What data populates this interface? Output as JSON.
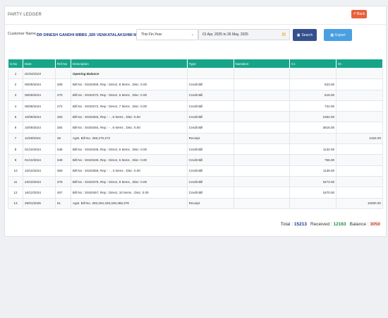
{
  "page": {
    "title": "PARTY LEDGER"
  },
  "back_button": {
    "label": "Back",
    "icon": "back-arrow-icon"
  },
  "customer": {
    "label": "Customer Name :",
    "name": "DR DINESH GANDHI MBBS ,SRI VENKATALAKSHMI MEDI CLINIC"
  },
  "filters": {
    "fin_year": "This Fin.Year",
    "date_range": "01 Apr, 2025 to 26 May, 2025"
  },
  "search_button": {
    "label": "Search",
    "icon": "save-icon"
  },
  "export_button": {
    "label": "Export",
    "icon": "export-icon"
  },
  "table": {
    "headers": [
      "S.No",
      "Date",
      "Ref.No",
      "Description",
      "Type",
      "Narration",
      "Cr.",
      "Dr."
    ],
    "rows": [
      {
        "sno": "1",
        "date": "01/04/2023",
        "ref": "",
        "desc": "Opening Balance",
        "type": "",
        "narr": "",
        "cr": "",
        "dr": ""
      },
      {
        "sno": "2",
        "date": "05/09/2024",
        "ref": "269",
        "desc": "Bill No : SSS0269, Rep : Direct, 8 Items , Disc: 0.00",
        "type": "Credit Bill",
        "narr": "",
        "cr": "623.00",
        "dr": ""
      },
      {
        "sno": "3",
        "date": "05/09/2024",
        "ref": "270",
        "desc": "Bill No : SSS0270, Rep : Direct, 6 Items , Disc: 0.00",
        "type": "Credit Bill",
        "narr": "",
        "cr": "618.00",
        "dr": ""
      },
      {
        "sno": "4",
        "date": "05/09/2024",
        "ref": "272",
        "desc": "Bill No : SSS0272, Rep : Direct, 7 Items , Disc: 0.00",
        "type": "Credit Bill",
        "narr": "",
        "cr": "722.00",
        "dr": ""
      },
      {
        "sno": "5",
        "date": "10/09/2024",
        "ref": "283",
        "desc": "Bill No : SSS0283, Rep : - , 6 Items , Disc: 0.00",
        "type": "Credit Bill",
        "narr": "",
        "cr": "1052.00",
        "dr": ""
      },
      {
        "sno": "6",
        "date": "10/09/2024",
        "ref": "284",
        "desc": "Bill No : SSS0284, Rep : - , 6 Items , Disc: 0.00",
        "type": "Credit Bill",
        "narr": "",
        "cr": "3816.00",
        "dr": ""
      },
      {
        "sno": "7",
        "date": "11/09/2024",
        "ref": "48",
        "desc": "Agst. Bill No. 269,270,272",
        "type": "Receipt",
        "narr": "",
        "cr": "",
        "dr": "2163.00"
      },
      {
        "sno": "8",
        "date": "01/10/2024",
        "ref": "348",
        "desc": "Bill No : SSS0348, Rep : Direct, 6 Items , Disc: 0.00",
        "type": "Credit Bill",
        "narr": "",
        "cr": "1132.00",
        "dr": ""
      },
      {
        "sno": "9",
        "date": "01/10/2024",
        "ref": "349",
        "desc": "Bill No : SSS0349, Rep : Direct, 6 Items , Disc: 0.00",
        "type": "Credit Bill",
        "narr": "",
        "cr": "766.00",
        "dr": ""
      },
      {
        "sno": "10",
        "date": "10/10/2024",
        "ref": "359",
        "desc": "Bill No : SSS0359, Rep : - , 3 Items , Disc: 0.00",
        "type": "Credit Bill",
        "narr": "",
        "cr": "1139.00",
        "dr": ""
      },
      {
        "sno": "11",
        "date": "23/10/2024",
        "ref": "378",
        "desc": "Bill No : SSS0378, Rep : Direct, 9 Items , Disc: 0.00",
        "type": "Credit Bill",
        "narr": "",
        "cr": "3473.00",
        "dr": ""
      },
      {
        "sno": "12",
        "date": "16/12/2024",
        "ref": "457",
        "desc": "Bill No : SSS0457, Rep : Direct, 10 Items , Disc: 0.00",
        "type": "Credit Bill",
        "narr": "",
        "cr": "1670.00",
        "dr": ""
      },
      {
        "sno": "13",
        "date": "29/01/2025",
        "ref": "61",
        "desc": "Agst. Bill No. 283,284,348,349,359,378",
        "type": "Receipt",
        "narr": "",
        "cr": "",
        "dr": "10000.00"
      }
    ]
  },
  "summary": {
    "total_label": "Total :",
    "total_value": "15213",
    "received_label": "Received :",
    "received_value": "12163",
    "balance_label": "Balance :",
    "balance_value": "3050"
  },
  "colors": {
    "header": "#17a589",
    "back": "#e8613c",
    "search": "#34508f",
    "export": "#4a9fe0",
    "received": "#1a8a3a",
    "balance": "#c0392b"
  }
}
